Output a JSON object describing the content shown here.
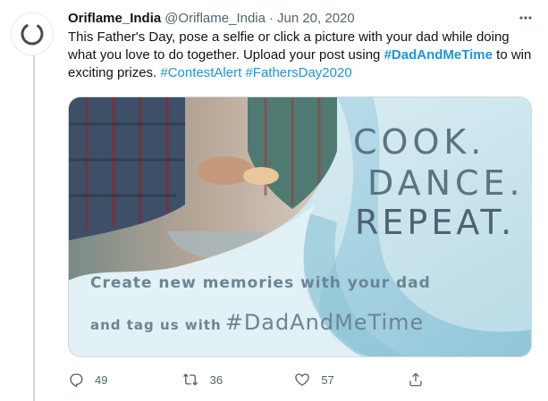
{
  "tweet": {
    "display_name": "Oriflame_India",
    "handle": "@Oriflame_India",
    "separator": "·",
    "date": "Jun 20, 2020",
    "text_part1": "This Father's Day, pose a selfie or click a picture with your dad while doing what you love to do together. Upload your post using ",
    "hashtag_main": "#DadAndMeTime",
    "text_part2": " to win exciting prizes. ",
    "hashtag_contest": "#ContestAlert",
    "hashtag_fathers": "#FathersDay2020"
  },
  "media": {
    "line1": "COOK.",
    "line2": "DANCE.",
    "line3": "REPEAT.",
    "subtitle1": "Create new memories with your dad",
    "subtitle2": "and tag us with",
    "subtitle_tag": "#DadAndMeTime"
  },
  "actions": {
    "replies": "49",
    "retweets": "36",
    "likes": "57"
  },
  "icons": {
    "more": "more-icon",
    "reply": "reply-icon",
    "retweet": "retweet-icon",
    "like": "heart-icon",
    "share": "share-icon",
    "avatar": "oriflame-logo-icon"
  },
  "colors": {
    "link": "#1b95e0",
    "muted": "#536471",
    "thread_line": "#cfd9de"
  }
}
